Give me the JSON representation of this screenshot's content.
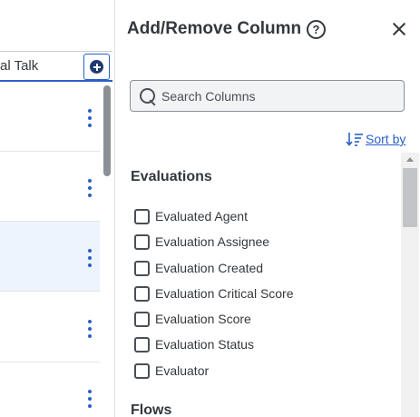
{
  "background_table": {
    "column_header_text": "al Talk",
    "add_column_button_icon": "plus-circle-icon",
    "row_action_icon": "kebab-menu-icon",
    "rows": [
      {
        "selected": false
      },
      {
        "selected": false
      },
      {
        "selected": true
      },
      {
        "selected": false
      },
      {
        "selected": false
      }
    ]
  },
  "panel": {
    "title": "Add/Remove Column",
    "help_icon_glyph": "?",
    "close_icon": "close-icon",
    "search": {
      "placeholder": "Search Columns",
      "value": ""
    },
    "sort_label": "Sort by",
    "groups": [
      {
        "title": "Evaluations",
        "items": [
          {
            "label": "Evaluated Agent",
            "checked": false
          },
          {
            "label": "Evaluation Assignee",
            "checked": false
          },
          {
            "label": "Evaluation Created",
            "checked": false
          },
          {
            "label": "Evaluation Critical Score",
            "checked": false
          },
          {
            "label": "Evaluation Score",
            "checked": false
          },
          {
            "label": "Evaluation Status",
            "checked": false
          },
          {
            "label": "Evaluator",
            "checked": false
          }
        ]
      },
      {
        "title": "Flows",
        "items": []
      }
    ]
  },
  "colors": {
    "accent": "#2a60c8",
    "text": "#33383d",
    "selected_row": "#eef4fd"
  }
}
